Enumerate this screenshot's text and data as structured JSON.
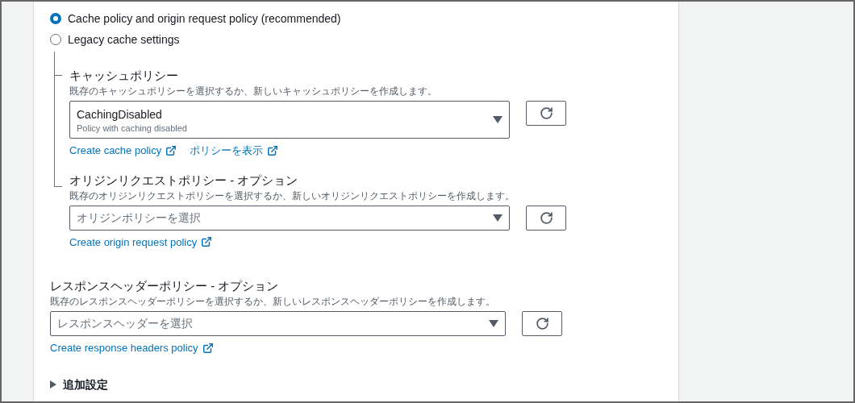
{
  "radios": [
    {
      "label": "Cache policy and origin request policy (recommended)",
      "selected": true
    },
    {
      "label": "Legacy cache settings",
      "selected": false
    }
  ],
  "tree_sections": [
    {
      "title": "キャッシュポリシー",
      "description": "既存のキャッシュポリシーを選択するか、新しいキャッシュポリシーを作成します。",
      "select": {
        "value": "CachingDisabled",
        "detail": "Policy with caching disabled"
      },
      "links": [
        {
          "label": "Create cache policy"
        },
        {
          "label": "ポリシーを表示"
        }
      ]
    },
    {
      "title": "オリジンリクエストポリシー - オプション",
      "description": "既存のオリジンリクエストポリシーを選択するか、新しいオリジンリクエストポリシーを作成します。",
      "select": {
        "placeholder": "オリジンポリシーを選択"
      },
      "links": [
        {
          "label": "Create origin request policy"
        }
      ]
    }
  ],
  "response_headers_section": {
    "title": "レスポンスヘッダーポリシー - オプション",
    "description": "既存のレスポンスヘッダーポリシーを選択するか、新しいレスポンスヘッダーポリシーを作成します。",
    "select": {
      "placeholder": "レスポンスヘッダーを選択"
    },
    "links": [
      {
        "label": "Create response headers policy"
      }
    ]
  },
  "additional_settings": {
    "label": "追加設定",
    "expanded": false
  }
}
